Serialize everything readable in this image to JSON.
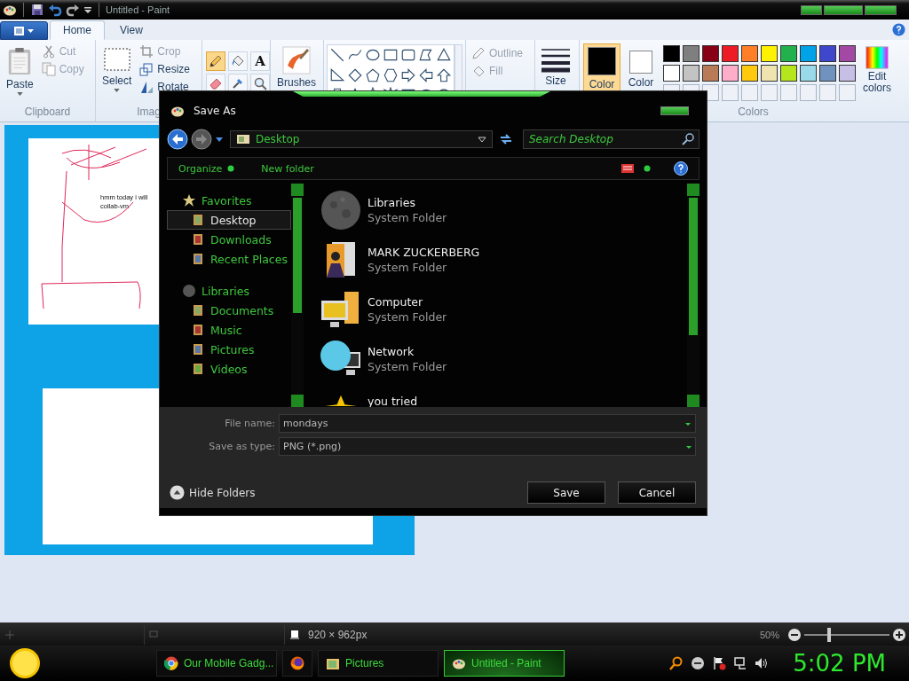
{
  "title_bar": {
    "title": "Untitled - Paint"
  },
  "ribbon_tabs": [
    {
      "label": "Home",
      "selected": true
    },
    {
      "label": "View",
      "selected": false
    }
  ],
  "clipboard": {
    "paste": "Paste",
    "cut": "Cut",
    "copy": "Copy",
    "label": "Clipboard"
  },
  "image": {
    "select": "Select",
    "crop": "Crop",
    "resize": "Resize",
    "rotate": "Rotate",
    "label": "Imag"
  },
  "tools": [
    {
      "kind": "pencil",
      "selected": true
    },
    {
      "kind": "fill",
      "selected": false
    },
    {
      "kind": "text",
      "glyph": "A",
      "selected": false
    },
    {
      "kind": "eraser",
      "selected": false
    },
    {
      "kind": "picker",
      "selected": false
    },
    {
      "kind": "magnifier",
      "selected": false
    }
  ],
  "brushes": "Brushes",
  "shape_style": {
    "outline": "Outline",
    "fill": "Fill"
  },
  "size": "Size",
  "color_slots": [
    {
      "label": "Color",
      "color": "#000000",
      "selected": true
    },
    {
      "label": "Color",
      "color": "#ffffff",
      "selected": false
    }
  ],
  "palette": [
    {
      "color": "#000000"
    },
    {
      "color": "#7f7f7f"
    },
    {
      "color": "#880015"
    },
    {
      "color": "#ed1c24"
    },
    {
      "color": "#ff7f27"
    },
    {
      "color": "#fff200"
    },
    {
      "color": "#22b14c"
    },
    {
      "color": "#00a2e8"
    },
    {
      "color": "#3f48cc"
    },
    {
      "color": "#a349a4"
    },
    {
      "color": "#ffffff"
    },
    {
      "color": "#c3c3c3"
    },
    {
      "color": "#b97a57"
    },
    {
      "color": "#ffaec9"
    },
    {
      "color": "#ffc90e"
    },
    {
      "color": "#efe4b0"
    },
    {
      "color": "#b5e61d"
    },
    {
      "color": "#99d9ea"
    },
    {
      "color": "#7092be"
    },
    {
      "color": "#c8bfe7"
    }
  ],
  "colors_label": "Colors",
  "edit_colors": "Edit colors",
  "canvas": {
    "note": "hmm today i will collab-vm"
  },
  "dialog": {
    "title": "Save As",
    "address": "Desktop",
    "search_placeholder": "Search Desktop",
    "toolbar": [
      "Organize",
      "New folder"
    ],
    "nav": [
      {
        "label": "Favorites",
        "kind": "favorites",
        "selected": false,
        "children": [
          {
            "label": "Desktop",
            "selected": true
          },
          {
            "label": "Downloads",
            "selected": false
          },
          {
            "label": "Recent Places",
            "selected": false
          }
        ]
      },
      {
        "label": "Libraries",
        "kind": "libraries",
        "selected": false,
        "children": [
          {
            "label": "Documents",
            "selected": false
          },
          {
            "label": "Music",
            "selected": false
          },
          {
            "label": "Pictures",
            "selected": false
          },
          {
            "label": "Videos",
            "selected": false
          }
        ]
      }
    ],
    "files": [
      {
        "name": "Libraries",
        "type": "System Folder",
        "kind": "library"
      },
      {
        "name": "MARK ZUCKERBERG",
        "type": "System Folder",
        "kind": "user"
      },
      {
        "name": "Computer",
        "type": "System Folder",
        "kind": "computer"
      },
      {
        "name": "Network",
        "type": "System Folder",
        "kind": "network"
      },
      {
        "name": "you tried",
        "kind": "shortcut"
      }
    ],
    "file_name_label": "File name:",
    "file_name": "mondays",
    "type_label": "Save as type:",
    "type": "PNG (*.png)",
    "hide_folders": "Hide Folders",
    "buttons": [
      "Save",
      "Cancel"
    ]
  },
  "status_bar": {
    "size": "920 × 962px",
    "zoom": {
      "reading": "50%",
      "level": 0.28
    }
  },
  "taskbar": {
    "tasks": [
      {
        "label": "Our Mobile Gadg...",
        "kind": "browser",
        "selected": false
      },
      {
        "kind": "firefox",
        "selected": false
      },
      {
        "label": "Pictures",
        "kind": "folder",
        "selected": false
      },
      {
        "label": "Untitled - Paint",
        "kind": "paint",
        "selected": true
      }
    ],
    "clock": "5:02 PM"
  }
}
